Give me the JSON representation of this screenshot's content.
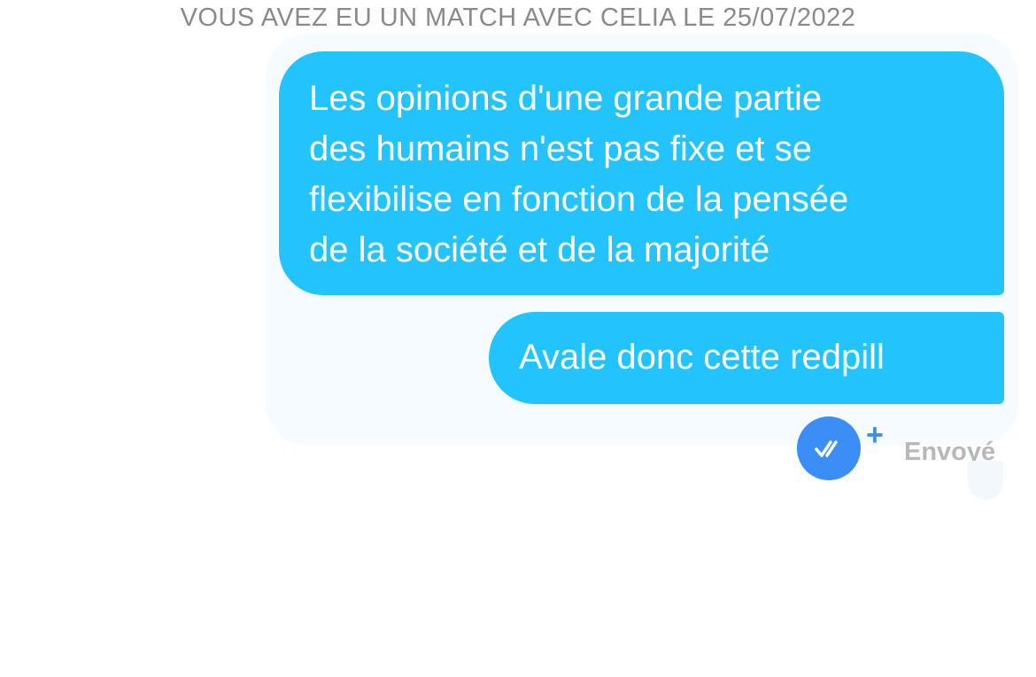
{
  "conversation": {
    "match_notice": "VOUS AVEZ EU UN MATCH AVEC CELIA LE 25/07/2022",
    "messages": [
      {
        "lines": [
          "Les opinions d'une grande partie",
          "des humains n'est pas fixe et se",
          "flexibilise en fonction de la pensée",
          "de la société et de la majorité"
        ]
      },
      {
        "lines": [
          "Avale donc cette redpill"
        ]
      }
    ],
    "status": {
      "icon": "double-check-icon",
      "extra_icon": "plus-icon",
      "plus_symbol": "+",
      "label": "Envoyé"
    }
  },
  "colors": {
    "bubble": "#23c3fe",
    "receipt": "#3a8ef5",
    "muted_text": "#8a8a8a"
  }
}
